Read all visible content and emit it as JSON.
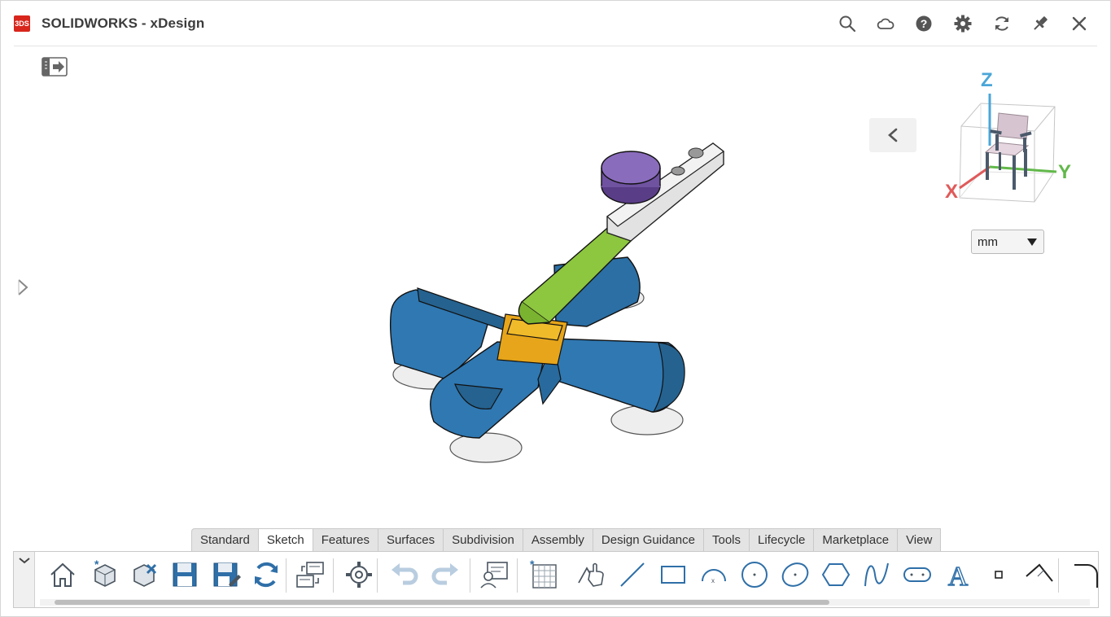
{
  "app": {
    "title": "SOLIDWORKS - xDesign",
    "logo_text": "3DS",
    "brand_color": "#d8261c"
  },
  "titlebar": {
    "buttons": [
      "search-icon",
      "cloud-icon",
      "help-icon",
      "gear-icon",
      "refresh-icon",
      "pin-icon",
      "close-icon"
    ]
  },
  "viewcube": {
    "axis_z": "Z",
    "axis_x": "X",
    "axis_y": "Y",
    "z_color": "#4aa6d8",
    "x_color": "#e05a5a",
    "y_color": "#62b84a"
  },
  "units": {
    "selected": "mm"
  },
  "tabs": [
    "Standard",
    "Sketch",
    "Features",
    "Surfaces",
    "Subdivision",
    "Assembly",
    "Design Guidance",
    "Tools",
    "Lifecycle",
    "Marketplace",
    "View"
  ],
  "active_tab": "Sketch",
  "toolbar": {
    "tools": [
      "home-icon",
      "new-part-icon",
      "delete-part-icon",
      "save-icon",
      "save-as-icon",
      "rebuild-icon",
      "replace-icon",
      "settings-icon",
      "undo-icon",
      "redo-icon",
      "feedback-icon",
      "grid-icon",
      "select-sketch-icon",
      "line-icon",
      "rectangle-icon",
      "arc-icon",
      "circle-icon",
      "ellipse-icon",
      "polygon-icon",
      "spline-icon",
      "slot-icon",
      "text-icon",
      "point-icon",
      "construction-icon",
      "fillet-icon"
    ]
  }
}
